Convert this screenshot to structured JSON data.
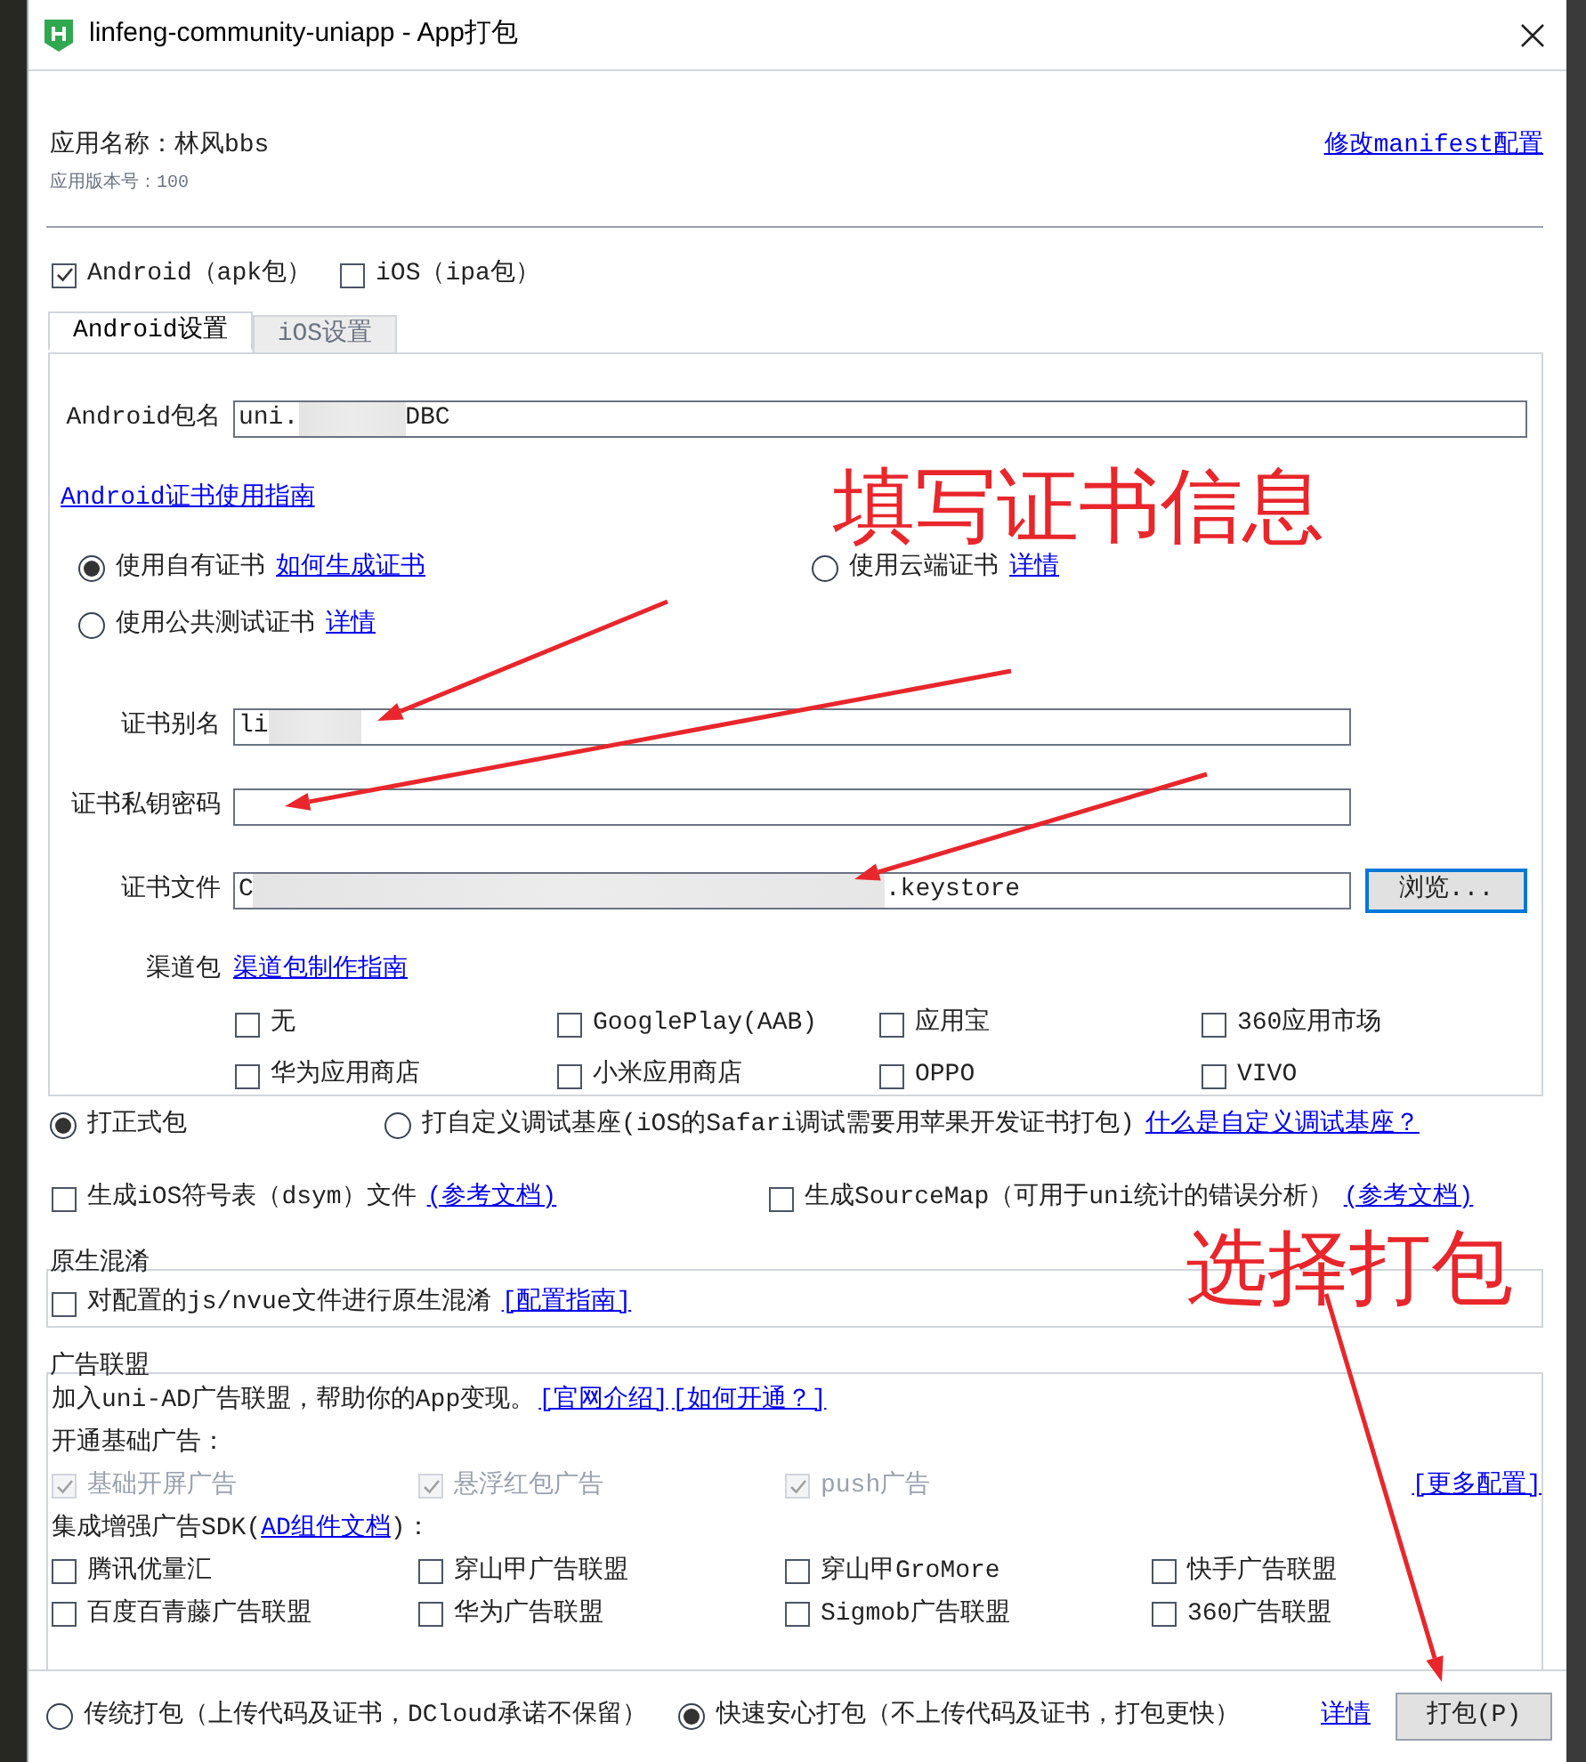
{
  "window": {
    "title": "linfeng-community-uniapp - App打包"
  },
  "app": {
    "name": "应用名称：林风bbs",
    "version": "应用版本号：100",
    "manifest_link": "修改manifest配置"
  },
  "platforms": [
    {
      "label": "Android（apk包）",
      "checked": true
    },
    {
      "label": "iOS（ipa包）",
      "checked": false
    }
  ],
  "tabs": [
    {
      "label": "Android设置",
      "selected": true
    },
    {
      "label": "iOS设置",
      "selected": false
    }
  ],
  "package": {
    "label": "Android包名",
    "value_start": "uni.",
    "value_end": "DBC",
    "redacted": true
  },
  "cert_guide_link": "Android证书使用指南",
  "cert_options": [
    {
      "label": "使用自有证书",
      "link": "如何生成证书",
      "selected": true
    },
    {
      "label": "使用云端证书",
      "link": "详情",
      "selected": false
    },
    {
      "label": "使用公共测试证书",
      "link": "详情",
      "selected": false
    }
  ],
  "cert_fields": [
    {
      "kind": "text",
      "label": "证书别名",
      "value_start": "li",
      "redacted": true
    },
    {
      "kind": "password",
      "label": "证书私钥密码"
    },
    {
      "kind": "file",
      "label": "证书文件",
      "value_start": "C",
      "value_end": ".keystore",
      "redacted": true,
      "button": "浏览..."
    }
  ],
  "channels": {
    "label": "渠道包",
    "link": "渠道包制作指南",
    "options": [
      {
        "label": "无",
        "checked": false
      },
      {
        "label": "GooglePlay(AAB)",
        "checked": false
      },
      {
        "label": "应用宝",
        "checked": false
      },
      {
        "label": "360应用市场",
        "checked": false
      },
      {
        "label": "华为应用商店",
        "checked": false
      },
      {
        "label": "小米应用商店",
        "checked": false
      },
      {
        "label": "OPPO",
        "checked": false
      },
      {
        "label": "VIVO",
        "checked": false
      }
    ]
  },
  "build_types": [
    {
      "label": "打正式包",
      "selected": true
    },
    {
      "label": "打自定义调试基座(iOS的Safari调试需要用苹果开发证书打包)",
      "link": "什么是自定义调试基座？",
      "selected": false
    }
  ],
  "extras": [
    {
      "label": "生成iOS符号表（dsym）文件",
      "link": "(参考文档)",
      "checked": false
    },
    {
      "label": "生成SourceMap（可用于uni统计的错误分析）",
      "link": "(参考文档)",
      "checked": false
    }
  ],
  "obfuscation": {
    "title": "原生混淆",
    "label": "对配置的js/nvue文件进行原生混淆",
    "checked": false,
    "link": "[配置指南]"
  },
  "ads": {
    "title": "广告联盟",
    "intro": "加入uni-AD广告联盟，帮助你的App变现。",
    "links": [
      "[官网介绍]",
      "[如何开通？]"
    ],
    "basic_title": "开通基础广告：",
    "basic": [
      {
        "label": "基础开屏广告",
        "checked": true,
        "disabled": true
      },
      {
        "label": "悬浮红包广告",
        "checked": true,
        "disabled": true
      },
      {
        "label": "push广告",
        "checked": true,
        "disabled": true
      }
    ],
    "more_link": "[更多配置]",
    "sdk_title_start": "集成增强广告SDK(",
    "sdk_link": "AD组件文档",
    "sdk_title_end": ")：",
    "sdk": [
      {
        "label": "腾讯优量汇",
        "checked": false
      },
      {
        "label": "穿山甲广告联盟",
        "checked": false
      },
      {
        "label": "穿山甲GroMore",
        "checked": false
      },
      {
        "label": "快手广告联盟",
        "checked": false
      },
      {
        "label": "百度百青藤广告联盟",
        "checked": false
      },
      {
        "label": "华为广告联盟",
        "checked": false
      },
      {
        "label": "Sigmob广告联盟",
        "checked": false
      },
      {
        "label": "360广告联盟",
        "checked": false
      }
    ]
  },
  "footer": {
    "modes": [
      {
        "label": "传统打包（上传代码及证书，DCloud承诺不保留）",
        "selected": false
      },
      {
        "label": "快速安心打包（不上传代码及证书，打包更快）",
        "selected": true
      }
    ],
    "details_link": "详情",
    "build_button": "打包(P)"
  },
  "annotations": [
    {
      "text": "填写证书信息"
    },
    {
      "text": "选择打包"
    }
  ]
}
